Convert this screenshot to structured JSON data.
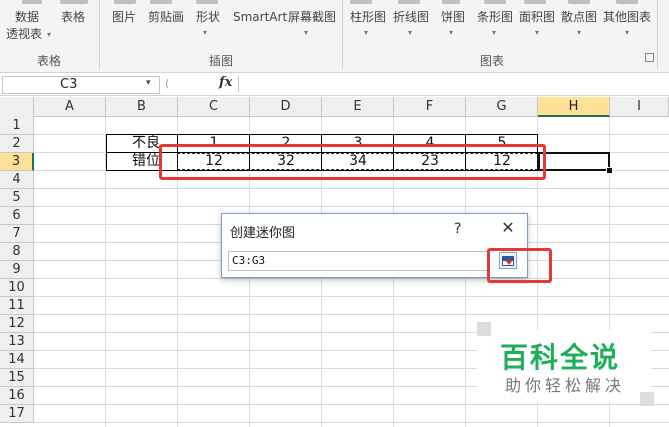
{
  "ribbon": {
    "buttons": [
      {
        "label": "数据"
      },
      {
        "label": "透视表"
      },
      {
        "label": "表格"
      },
      {
        "label": "图片"
      },
      {
        "label": "剪贴画"
      },
      {
        "label": "形状"
      },
      {
        "label": "SmartArt"
      },
      {
        "label": "屏幕截图"
      },
      {
        "label": "柱形图"
      },
      {
        "label": "折线图"
      },
      {
        "label": "饼图"
      },
      {
        "label": "条形图"
      },
      {
        "label": "面积图"
      },
      {
        "label": "散点图"
      },
      {
        "label": "其他图表"
      }
    ],
    "groups": [
      "表格",
      "插图",
      "图表"
    ]
  },
  "formula_bar": {
    "name_box": "C3",
    "fx": "fx",
    "content": ""
  },
  "grid": {
    "columns": [
      "A",
      "B",
      "C",
      "D",
      "E",
      "F",
      "G",
      "H",
      "I"
    ],
    "rows": [
      "1",
      "2",
      "3",
      "4",
      "5",
      "6",
      "7",
      "8",
      "9",
      "10",
      "11",
      "12",
      "13",
      "14",
      "15",
      "16",
      "17"
    ],
    "selected_column": "H",
    "selected_row": "3",
    "table": {
      "row2": {
        "label": "不良",
        "values": [
          "1",
          "2",
          "3",
          "4",
          "5"
        ]
      },
      "row3": {
        "label": "错位",
        "values": [
          "12",
          "32",
          "34",
          "23",
          "12"
        ]
      }
    }
  },
  "dialog": {
    "title": "创建迷你图",
    "help": "?",
    "close": "✕",
    "range_value": "C3:G3"
  },
  "watermark": {
    "main": "百科全说",
    "sub": "助你轻松解决"
  },
  "colors": {
    "highlight": "#e53935",
    "selected_header": "#fce196",
    "excel_green": "#217346",
    "watermark_green": "#1fae5b"
  }
}
